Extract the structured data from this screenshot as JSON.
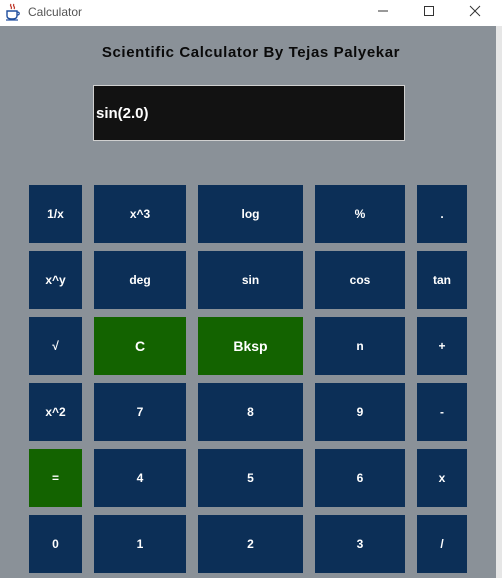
{
  "window": {
    "title": "Calculator",
    "icon": "java-cup-icon",
    "controls": [
      "minimize-icon",
      "maximize-icon",
      "close-icon"
    ]
  },
  "heading": "Scientific Calculator By Tejas Palyekar",
  "display": {
    "value": "sin(2.0)"
  },
  "colors": {
    "background": "#8a9198",
    "key": "#0c2f57",
    "key_accent": "#136300",
    "display": "#121212"
  },
  "keys": {
    "r1": [
      "1/x",
      "x^3",
      "log",
      "%",
      "."
    ],
    "r2": [
      "x^y",
      "deg",
      "sin",
      "cos",
      "tan"
    ],
    "r3": [
      "√",
      "C",
      "Bksp",
      "n",
      "+"
    ],
    "r4": [
      "x^2",
      "7",
      "8",
      "9",
      "-"
    ],
    "r5": [
      "=",
      "4",
      "5",
      "6",
      "x"
    ],
    "r6": [
      "0",
      "1",
      "2",
      "3",
      "/"
    ]
  }
}
